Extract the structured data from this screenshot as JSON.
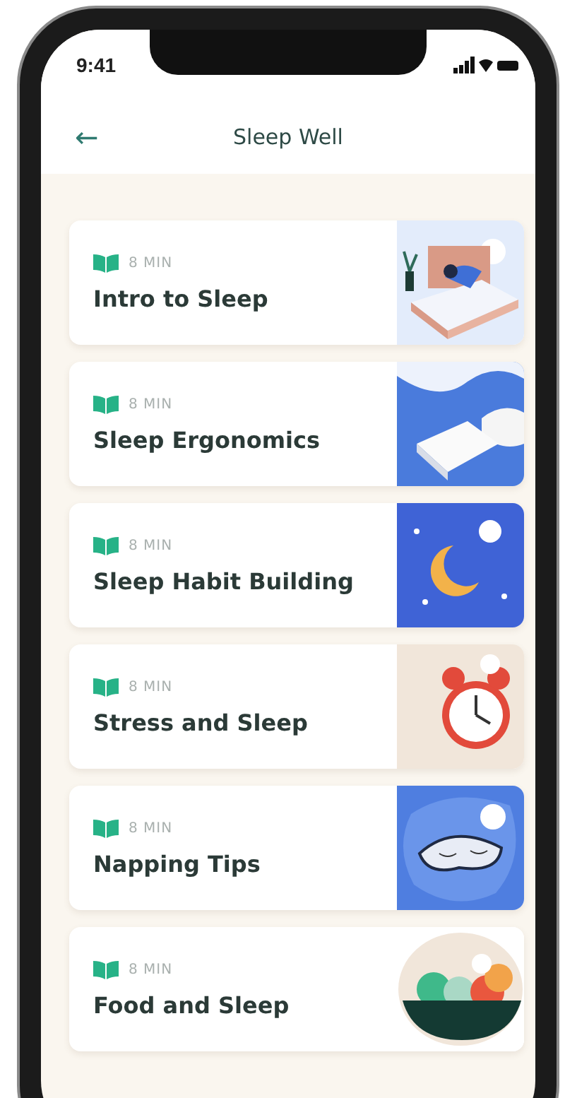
{
  "status_bar": {
    "time": "9:41"
  },
  "header": {
    "back": "←",
    "title": "Sleep Well"
  },
  "lessons": [
    {
      "duration": "8 MIN",
      "title": "Intro to Sleep",
      "kind": "bed"
    },
    {
      "duration": "8 MIN",
      "title": "Sleep Ergonomics",
      "kind": "pillow"
    },
    {
      "duration": "8 MIN",
      "title": "Sleep Habit Building",
      "kind": "moon"
    },
    {
      "duration": "8 MIN",
      "title": "Stress and Sleep",
      "kind": "clock"
    },
    {
      "duration": "8 MIN",
      "title": "Napping Tips",
      "kind": "mask"
    },
    {
      "duration": "8 MIN",
      "title": "Food and Sleep",
      "kind": "fruit"
    }
  ]
}
